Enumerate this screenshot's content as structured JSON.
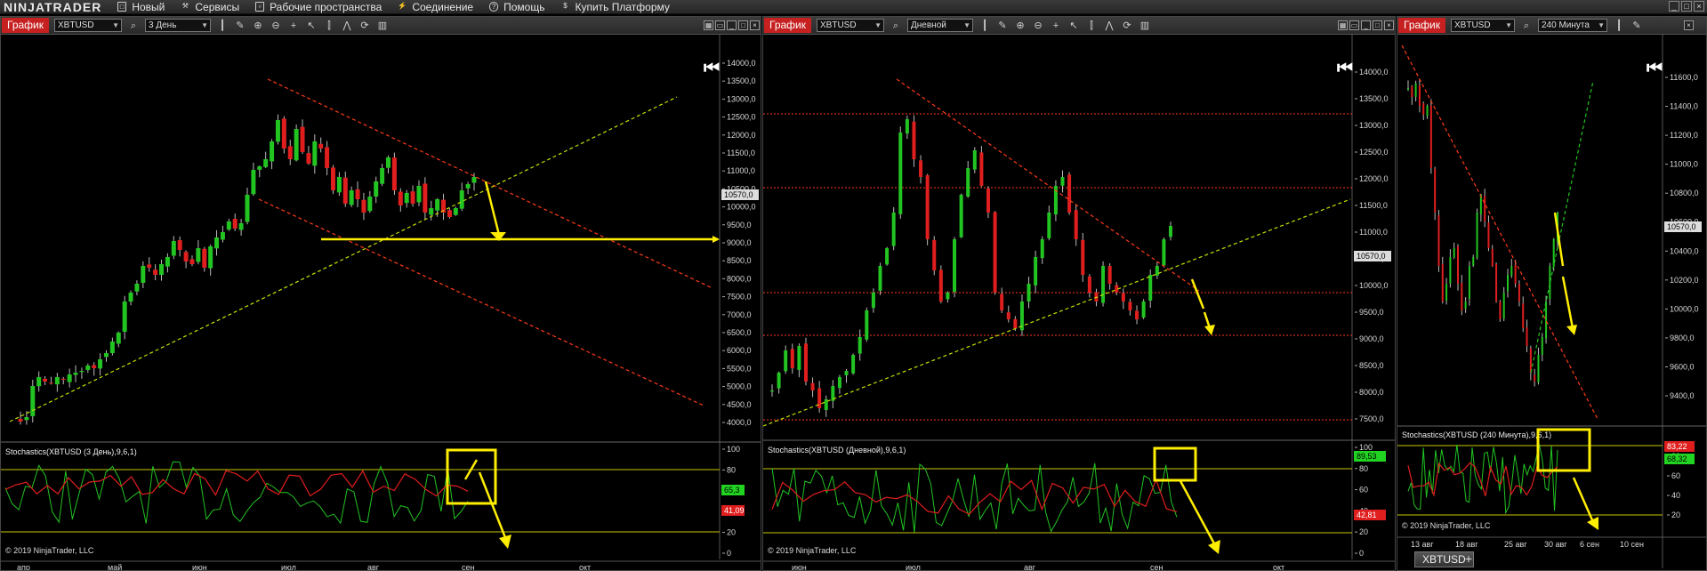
{
  "app": {
    "logo": "NINJATRADER",
    "menu": [
      {
        "label": "Новый",
        "icon": "new-document-icon"
      },
      {
        "label": "Сервисы",
        "icon": "tools-icon"
      },
      {
        "label": "Рабочие пространства",
        "icon": "workspace-icon"
      },
      {
        "label": "Соединение",
        "icon": "connection-icon"
      },
      {
        "label": "Помощь",
        "icon": "help-icon"
      },
      {
        "label": "Купить Платформу",
        "icon": "dollar-icon"
      }
    ],
    "bottom_tab": "XBTUSD",
    "add_tab": "+"
  },
  "panels": [
    {
      "title": "График",
      "instrument": "XBTUSD",
      "period": "3 День",
      "price_labels": [
        "14000,0",
        "13500,0",
        "13000,0",
        "12500,0",
        "12000,0",
        "11500,0",
        "11000,0",
        "10500,0",
        "10000,0",
        "9500,0",
        "9000,0",
        "8500,0",
        "8000,0",
        "7500,0",
        "7000,0",
        "6500,0",
        "6000,0",
        "5500,0",
        "5000,0",
        "4500,0",
        "4000,0"
      ],
      "last_price": "10570,0",
      "indicator_title": "Stochastics(XBTUSD (3 День),9,6,1)",
      "osc_labels": [
        "100",
        "80",
        "60",
        "40",
        "20",
        "0"
      ],
      "osc_badge_green": "65,3",
      "osc_badge_red": "41,09",
      "copyright": "© 2019 NinjaTrader, LLC",
      "time_labels": [
        "апр",
        "май",
        "июн",
        "июл",
        "авг",
        "сен",
        "окт"
      ]
    },
    {
      "title": "График",
      "instrument": "XBTUSD",
      "period": "Дневной",
      "price_labels": [
        "14000,0",
        "13500,0",
        "13000,0",
        "12500,0",
        "12000,0",
        "11500,0",
        "11000,0",
        "10500,0",
        "10000,0",
        "9500,0",
        "9000,0",
        "8500,0",
        "8000,0",
        "7500,0"
      ],
      "last_price": "10570,0",
      "indicator_title": "Stochastics(XBTUSD (Дневной),9,6,1)",
      "osc_labels": [
        "100",
        "80",
        "60",
        "40",
        "20",
        "0"
      ],
      "osc_badge_green": "89,53",
      "osc_badge_red": "42,81",
      "copyright": "© 2019 NinjaTrader, LLC",
      "time_labels": [
        "июн",
        "июл",
        "авг",
        "сен",
        "окт"
      ]
    },
    {
      "title": "График",
      "instrument": "XBTUSD",
      "period": "240 Минута",
      "price_labels": [
        "11600,0",
        "11400,0",
        "11200,0",
        "11000,0",
        "10800,0",
        "10600,0",
        "10400,0",
        "10200,0",
        "10000,0",
        "9800,0",
        "9600,0",
        "9400,0"
      ],
      "last_price": "10570,0",
      "indicator_title": "Stochastics(XBTUSD (240 Минута),9,6,1)",
      "osc_labels": [
        "80",
        "60",
        "40",
        "20"
      ],
      "osc_badge_red": "83,22",
      "osc_badge_green": "68,32",
      "copyright": "© 2019 NinjaTrader, LLC",
      "time_labels": [
        "13 авг",
        "18 авг",
        "25 авг",
        "30 авг",
        "6 сен",
        "10 сен"
      ]
    }
  ],
  "colors": {
    "up": "#22c422",
    "down": "#e01e1e",
    "trend_red": "#ff3a1a",
    "trend_green": "#c8e000",
    "annotation": "#ffee00",
    "panel_title": "#c62020"
  }
}
